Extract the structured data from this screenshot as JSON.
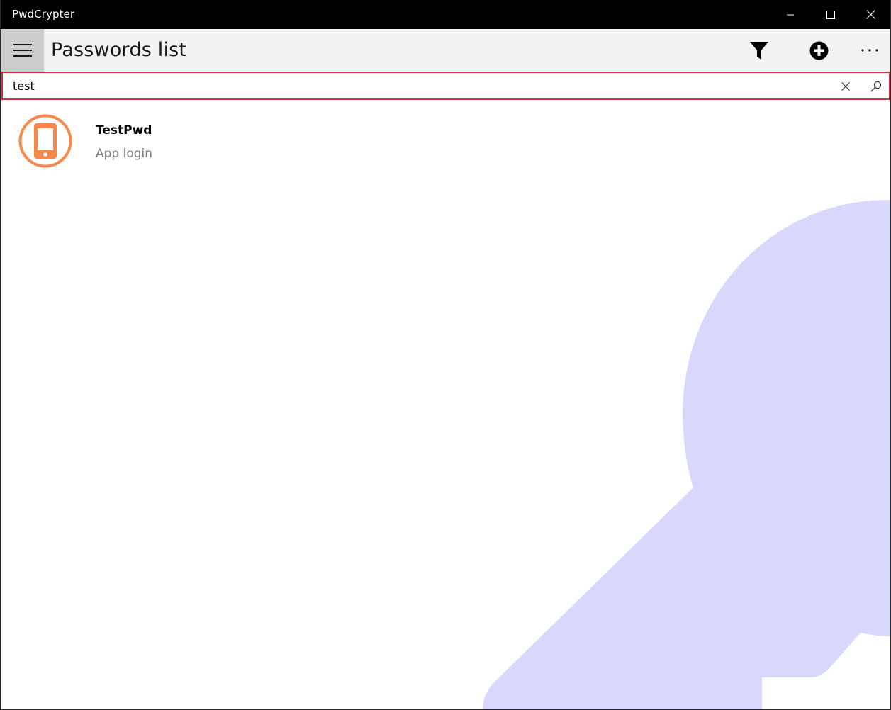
{
  "window": {
    "title": "PwdCrypter"
  },
  "header": {
    "page_title": "Passwords list"
  },
  "search": {
    "value": "test",
    "placeholder": ""
  },
  "passwords": [
    {
      "name": "TestPwd",
      "category": "App login",
      "icon": "smartphone-icon",
      "icon_color": "#f7894a"
    }
  ],
  "colors": {
    "accent_border": "#d13438",
    "background_key": "#d8d8fc",
    "header_bg": "#f2f2f2",
    "hamburger_bg": "#cccccc"
  }
}
